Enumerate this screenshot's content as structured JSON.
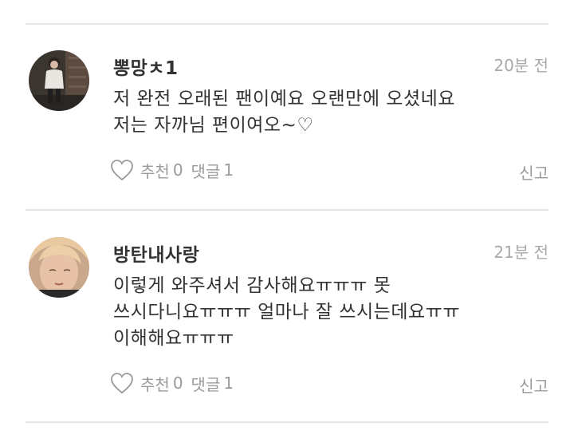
{
  "comments": [
    {
      "author": "뽕망ㅊ1",
      "time": "20분 전",
      "lines": [
        "저 완전 오래된 팬이예요 오랜만에 오셨네요",
        "저는 자까님 편이여오~♡"
      ],
      "like_label": "추천",
      "like_count": "0",
      "reply_label": "댓글",
      "reply_count": "1",
      "report_label": "신고"
    },
    {
      "author": "방탄내사랑",
      "time": "21분 전",
      "lines": [
        "이렇게 와주셔서 감사해요ㅠㅠㅠ 못",
        "쓰시다니요ㅠㅠㅠ 얼마나 잘 쓰시는데요ㅠㅠ",
        "이해해요ㅠㅠㅠ"
      ],
      "like_label": "추천",
      "like_count": "0",
      "reply_label": "댓글",
      "reply_count": "1",
      "report_label": "신고"
    }
  ],
  "icons": {
    "like": "heart-outline-icon",
    "avatar": "user-avatar"
  },
  "colors": {
    "text": "#333333",
    "muted": "#9a9a9a",
    "divider": "#e6e6e6"
  }
}
